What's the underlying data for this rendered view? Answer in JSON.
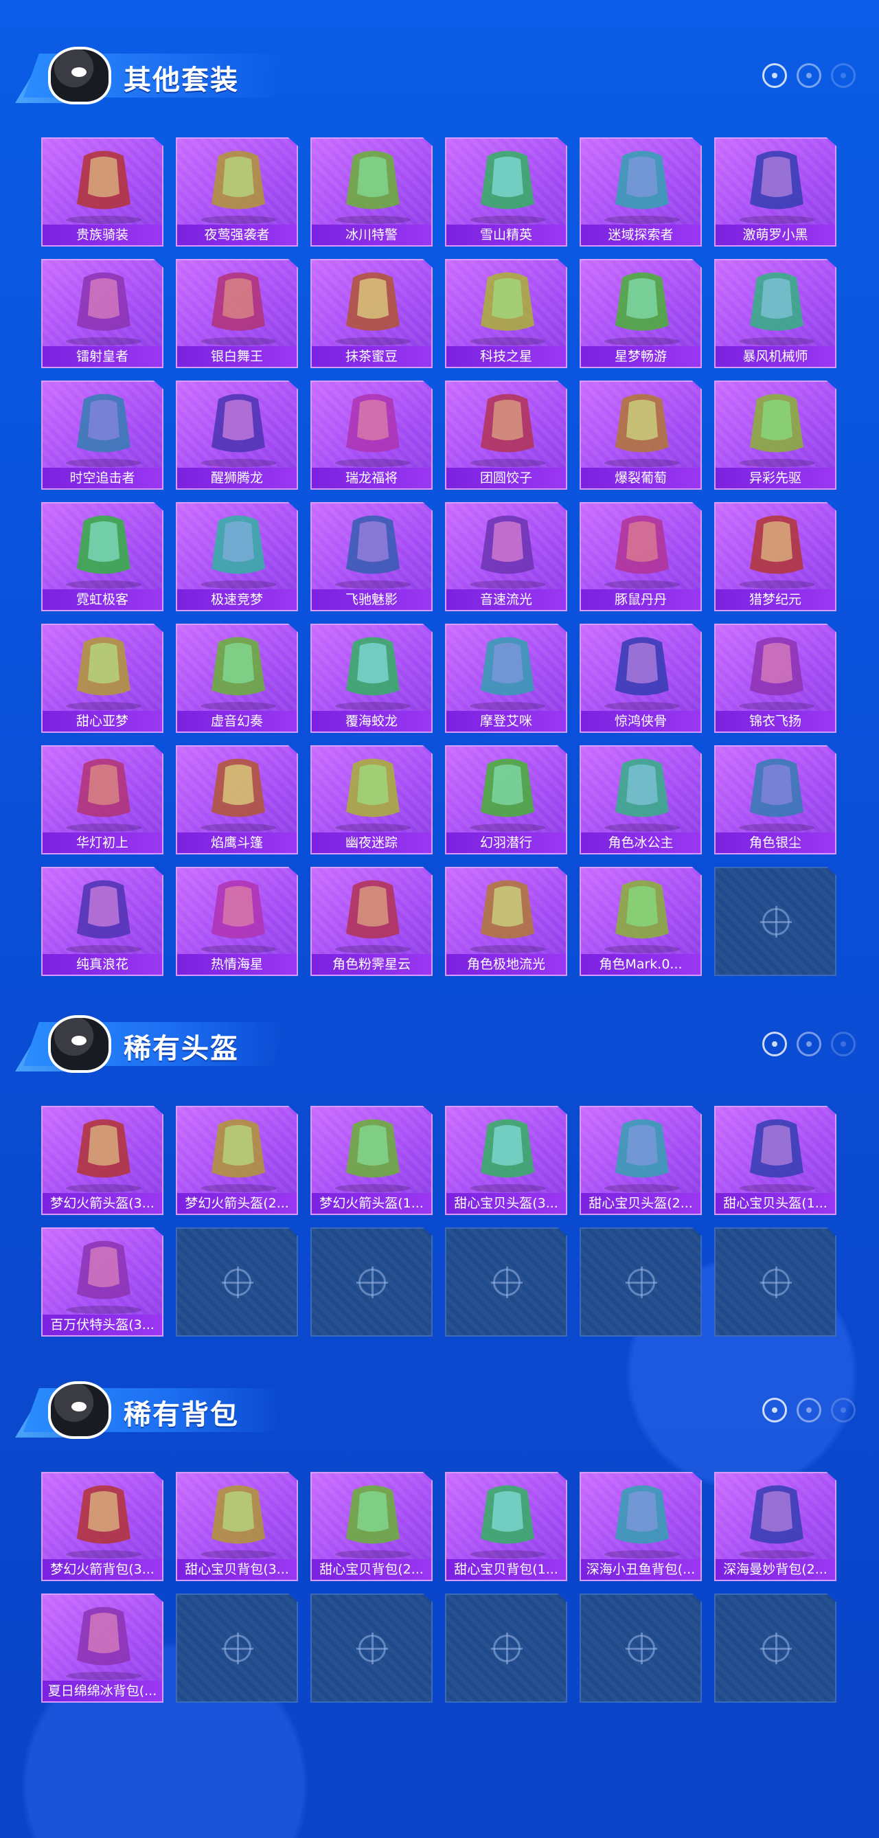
{
  "colors": {
    "background": "#0a4fd8",
    "card_purple": "#a74ef6",
    "label_bar": "#7b22e0",
    "empty_slot": "#1f4a8c"
  },
  "sections": [
    {
      "title": "其他套装",
      "items": [
        "贵族骑装",
        "夜莺强袭者",
        "冰川特警",
        "雪山精英",
        "迷域探索者",
        "激萌罗小黑",
        "镭射皇者",
        "银白舞王",
        "抹茶蜜豆",
        "科技之星",
        "星梦畅游",
        "暴风机械师",
        "时空追击者",
        "醒狮腾龙",
        "瑞龙福将",
        "团圆饺子",
        "爆裂葡萄",
        "异彩先驱",
        "霓虹极客",
        "极速竞梦",
        "飞驰魅影",
        "音速流光",
        "豚鼠丹丹",
        "猎梦纪元",
        "甜心亚梦",
        "虚音幻奏",
        "覆海蛟龙",
        "摩登艾咪",
        "惊鸿侠骨",
        "锦衣飞扬",
        "华灯初上",
        "焰鹰斗篷",
        "幽夜迷踪",
        "幻羽潜行",
        "角色冰公主",
        "角色银尘",
        "纯真浪花",
        "热情海星",
        "角色粉霁星云",
        "角色极地流光",
        "角色Mark.0..."
      ],
      "empty_slots": 1
    },
    {
      "title": "稀有头盔",
      "items": [
        "梦幻火箭头盔(3...",
        "梦幻火箭头盔(2...",
        "梦幻火箭头盔(1...",
        "甜心宝贝头盔(3...",
        "甜心宝贝头盔(2...",
        "甜心宝贝头盔(1...",
        "百万伏特头盔(3..."
      ],
      "empty_slots": 5
    },
    {
      "title": "稀有背包",
      "items": [
        "梦幻火箭背包(3...",
        "甜心宝贝背包(3...",
        "甜心宝贝背包(2...",
        "甜心宝贝背包(1...",
        "深海小丑鱼背包(...",
        "深海曼妙背包(2...",
        "夏日绵绵冰背包(..."
      ],
      "empty_slots": 5
    }
  ]
}
